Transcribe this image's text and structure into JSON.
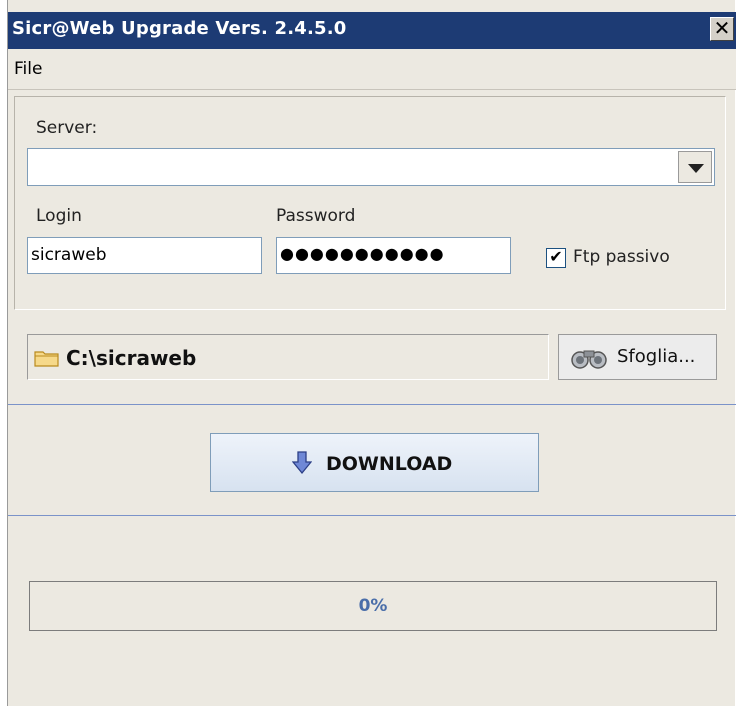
{
  "window": {
    "title": "Sicr@Web Upgrade Vers. 2.4.5.0",
    "close_label": "✕"
  },
  "menu": {
    "file": "File"
  },
  "connection": {
    "server_label": "Server:",
    "server_value": "",
    "login_label": "Login",
    "login_value": "sicraweb",
    "password_label": "Password",
    "password_value": "●●●●●●●●●●●",
    "ftp_passive_label": "Ftp passivo",
    "ftp_passive_checked": true
  },
  "destination": {
    "path": "C:\\sicraweb",
    "browse_label": "Sfoglia..."
  },
  "download": {
    "label": "DOWNLOAD"
  },
  "progress": {
    "text": "0%",
    "value": 0
  },
  "colors": {
    "titlebar": "#1d3b74",
    "accent": "#4a6ea9",
    "separator": "#7b93c9"
  }
}
